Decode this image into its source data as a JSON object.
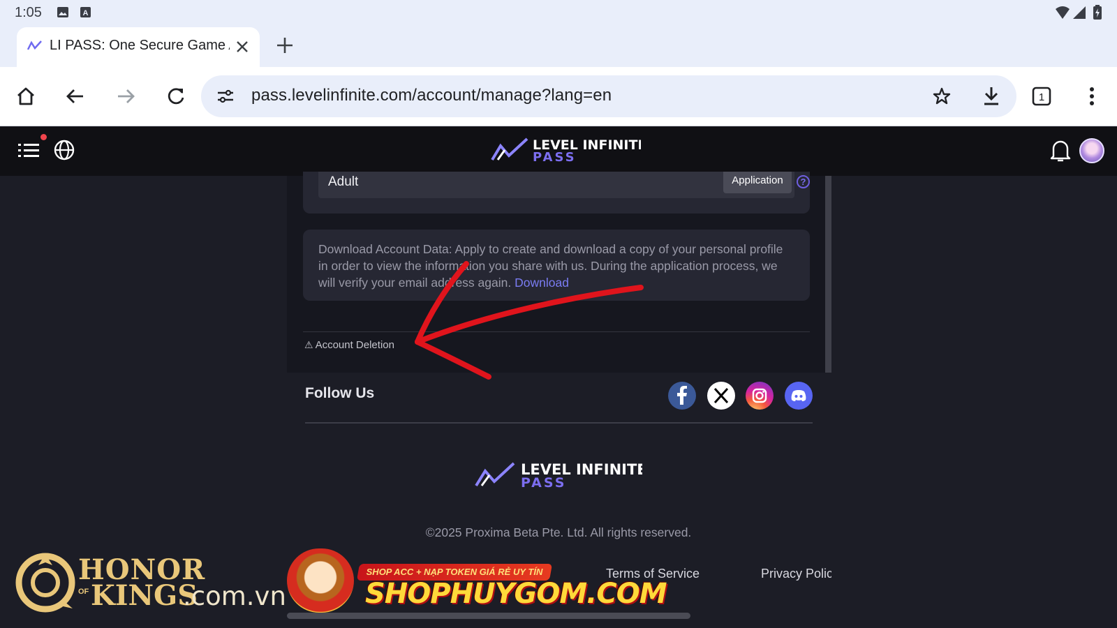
{
  "status_bar": {
    "time": "1:05"
  },
  "browser": {
    "tab": {
      "title": "LI PASS: One Secure Game A"
    },
    "url": "pass.levelinfinite.com/account/manage?lang=en",
    "tab_count": "1"
  },
  "site": {
    "logo_top": "LEVEL INFINITE",
    "logo_bottom": "PASS",
    "age": {
      "value": "Adult",
      "application_button": "Application",
      "help": "?"
    },
    "download": {
      "text": "Download Account Data: Apply to create and download a copy of your personal profile in order to view the information you share with us. During the application process, we will verify your email address again.",
      "link": "Download"
    },
    "deletion": {
      "icon": "⚠",
      "label": "Account Deletion"
    },
    "follow": {
      "title": "Follow Us",
      "icons": [
        "facebook-icon",
        "x-icon",
        "instagram-icon",
        "discord-icon"
      ]
    },
    "footer": {
      "copyright": "©2025 Proxima Beta Pte. Ltd. All rights reserved.",
      "terms": "Terms of Service",
      "privacy": "Privacy Polic"
    }
  },
  "watermarks": {
    "hok_line1": "HONOR",
    "hok_of": "OF",
    "hok_line2": "KINGS",
    "hok_domain": ".com.vn",
    "shop_banner": "SHOP ACC + NẠP TOKEN GIÁ RẺ UY TÍN",
    "shop_name": "SHOPHUYGOM.COM"
  },
  "colors": {
    "accent": "#7a7cf2",
    "page_bg": "#1c1d26",
    "card_bg": "#262733",
    "arrow": "#e0141c"
  }
}
